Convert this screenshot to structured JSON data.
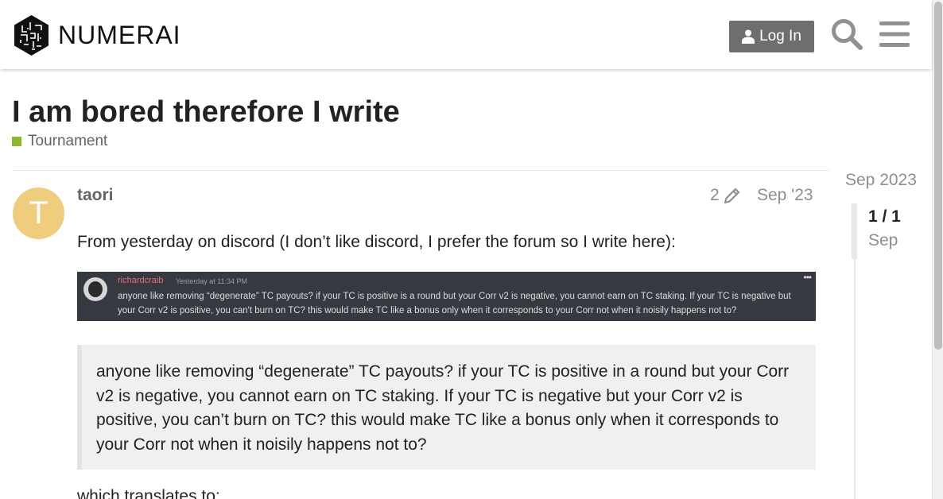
{
  "header": {
    "logo_text": "NUMERAI",
    "login_label": "Log In",
    "search_icon": "search-icon",
    "menu_icon": "hamburger-menu-icon"
  },
  "topic": {
    "title": "I am bored therefore I write",
    "category": "Tournament",
    "category_color": "#8cb82f"
  },
  "post": {
    "avatar_letter": "T",
    "avatar_color": "#efcd7d",
    "username": "taori",
    "edit_count": "2",
    "date": "Sep '23",
    "intro": "From yesterday on discord (I don’t like discord, I prefer the forum so I write here):",
    "embedded_image": {
      "author": "richardcraib",
      "time": "Yesterday at 11:34 PM",
      "message": "anyone like removing “degenerate” TC payouts? if your TC is positive is a round but your Corr v2 is negative, you cannot earn on TC staking. If your TC is negative but your Corr v2 is positive, you can't burn on TC? this would make TC like a bonus only when it corresponds to your Corr not when it noisily happens not to?",
      "dots": "•••"
    },
    "quote": "anyone like removing “degenerate” TC payouts? if your TC is positive in a round but your Corr v2 is negative, you cannot earn on TC staking. If your TC is negative but your Corr v2 is positive, you can’t burn on TC? this would make TC like a bonus only when it corresponds to your Corr not when it noisily happens not to?",
    "next_line": "which translates to:"
  },
  "timeline": {
    "start_date": "Sep 2023",
    "count": "1 / 1",
    "current_date": "Sep"
  }
}
